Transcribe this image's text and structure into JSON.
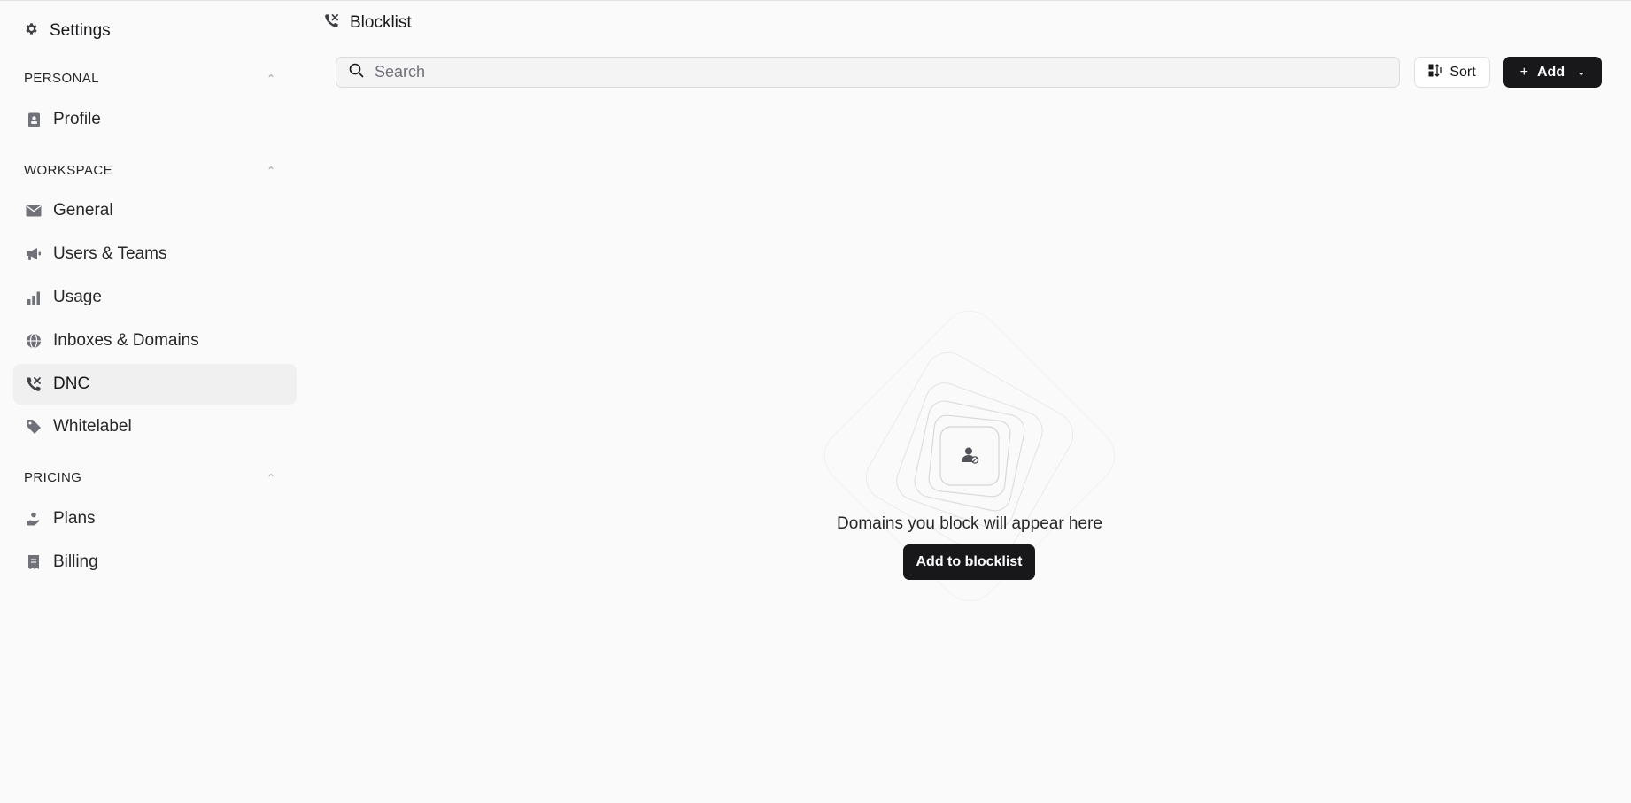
{
  "sidebar": {
    "header": {
      "label": "Settings",
      "icon": "gear-icon"
    },
    "sections": {
      "personal": {
        "title": "PERSONAL"
      },
      "workspace": {
        "title": "WORKSPACE"
      },
      "pricing": {
        "title": "PRICING"
      }
    },
    "items": [
      {
        "label": "Profile",
        "icon": "badge-icon"
      },
      {
        "label": "General",
        "icon": "envelope-icon"
      },
      {
        "label": "Users & Teams",
        "icon": "megaphone-icon"
      },
      {
        "label": "Usage",
        "icon": "bar-chart-icon"
      },
      {
        "label": "Inboxes & Domains",
        "icon": "globe-icon"
      },
      {
        "label": "DNC",
        "icon": "phone-off-icon",
        "active": true
      },
      {
        "label": "Whitelabel",
        "icon": "tag-icon"
      },
      {
        "label": "Plans",
        "icon": "hand-coins-icon"
      },
      {
        "label": "Billing",
        "icon": "receipt-icon"
      }
    ]
  },
  "header": {
    "title": "Blocklist",
    "icon": "phone-off-icon"
  },
  "toolbar": {
    "search_placeholder": "Search",
    "sort_label": "Sort",
    "add_label": "Add",
    "add_prefix": "+"
  },
  "empty_state": {
    "message": "Domains you block will appear here",
    "cta_label": "Add to blocklist",
    "icon": "user-blocked-icon"
  },
  "colors": {
    "background": "#fafafa",
    "active_item": "#f0f0f0",
    "primary_button": "#18181b",
    "icon_gray": "#71717a"
  }
}
